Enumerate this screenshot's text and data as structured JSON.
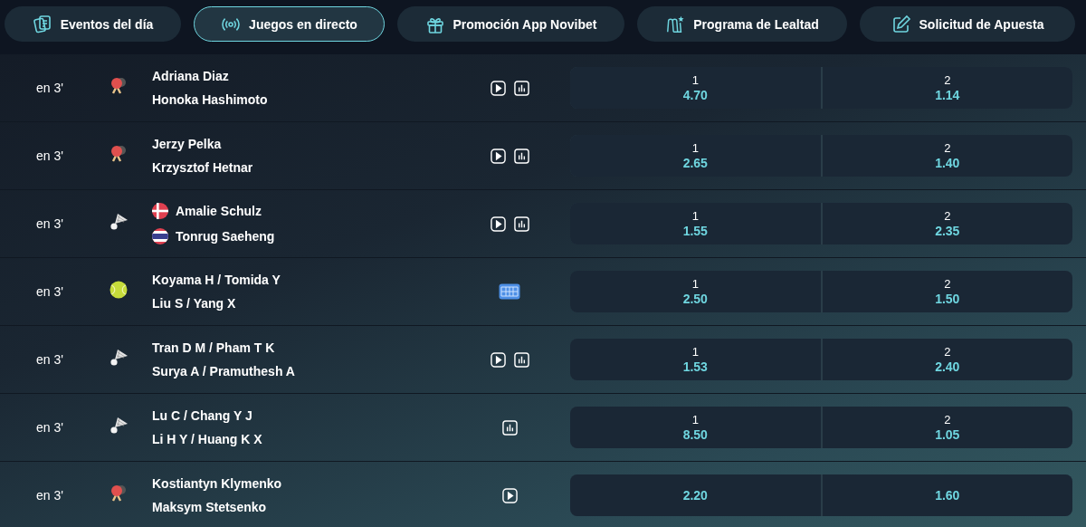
{
  "tabs": [
    {
      "label": "Eventos del día",
      "selected": false
    },
    {
      "label": "Juegos en directo",
      "selected": true
    },
    {
      "label": "Promoción App Novibet",
      "selected": false
    },
    {
      "label": "Programa de Lealtad",
      "selected": false
    },
    {
      "label": "Solicitud de Apuesta",
      "selected": false
    }
  ],
  "events": [
    {
      "time": "en 3'",
      "kind": "pingpong",
      "players": [
        {
          "name": "Adriana Diaz",
          "kind": "plain"
        },
        {
          "name": "Honoka Hashimoto",
          "kind": "plain"
        }
      ],
      "media": [
        {
          "kind": "video"
        },
        {
          "kind": "stats"
        }
      ],
      "odds": [
        {
          "label": "1",
          "value": "4.70"
        },
        {
          "label": "2",
          "value": "1.14"
        }
      ]
    },
    {
      "time": "en 3'",
      "kind": "pingpong",
      "players": [
        {
          "name": "Jerzy Pelka",
          "kind": "plain"
        },
        {
          "name": "Krzysztof Hetnar",
          "kind": "plain"
        }
      ],
      "media": [
        {
          "kind": "video"
        },
        {
          "kind": "stats"
        }
      ],
      "odds": [
        {
          "label": "1",
          "value": "2.65"
        },
        {
          "label": "2",
          "value": "1.40"
        }
      ]
    },
    {
      "time": "en 3'",
      "kind": "badminton",
      "players": [
        {
          "name": "Amalie Schulz",
          "kind": "danish"
        },
        {
          "name": "Tonrug Saeheng",
          "kind": "thai"
        }
      ],
      "media": [
        {
          "kind": "video"
        },
        {
          "kind": "stats"
        }
      ],
      "odds": [
        {
          "label": "1",
          "value": "1.55"
        },
        {
          "label": "2",
          "value": "2.35"
        }
      ]
    },
    {
      "time": "en 3'",
      "kind": "tennis",
      "players": [
        {
          "name": "Koyama H / Tomida Y",
          "kind": "plain"
        },
        {
          "name": "Liu S / Yang X",
          "kind": "plain"
        }
      ],
      "media": [
        {
          "kind": "court"
        }
      ],
      "odds": [
        {
          "label": "1",
          "value": "2.50"
        },
        {
          "label": "2",
          "value": "1.50"
        }
      ]
    },
    {
      "time": "en 3'",
      "kind": "badminton",
      "players": [
        {
          "name": "Tran D M / Pham T K",
          "kind": "plain"
        },
        {
          "name": "Surya A / Pramuthesh A",
          "kind": "plain"
        }
      ],
      "media": [
        {
          "kind": "video"
        },
        {
          "kind": "stats"
        }
      ],
      "odds": [
        {
          "label": "1",
          "value": "1.53"
        },
        {
          "label": "2",
          "value": "2.40"
        }
      ]
    },
    {
      "time": "en 3'",
      "kind": "badminton",
      "players": [
        {
          "name": "Lu C / Chang Y J",
          "kind": "plain"
        },
        {
          "name": "Li H Y / Huang K X",
          "kind": "plain"
        }
      ],
      "media": [
        {
          "kind": "stats"
        }
      ],
      "odds": [
        {
          "label": "1",
          "value": "8.50"
        },
        {
          "label": "2",
          "value": "1.05"
        }
      ]
    },
    {
      "time": "en 3'",
      "kind": "pingpong",
      "players": [
        {
          "name": "Kostiantyn Klymenko",
          "kind": "plain"
        },
        {
          "name": "Maksym Stetsenko",
          "kind": "plain"
        }
      ],
      "media": [
        {
          "kind": "video"
        }
      ],
      "odds": [
        {
          "value": "2.20"
        },
        {
          "value": "1.60"
        }
      ]
    }
  ]
}
